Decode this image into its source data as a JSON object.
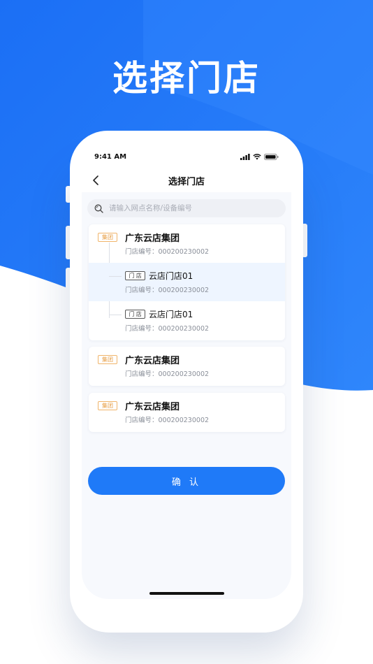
{
  "hero": {
    "title": "选择门店"
  },
  "status_bar": {
    "time": "9:41 AM"
  },
  "nav": {
    "title": "选择门店"
  },
  "search": {
    "placeholder": "请输入网点名称/设备编号"
  },
  "cards": [
    {
      "group": {
        "tag": "集团",
        "name": "广东云店集团",
        "code": "门店编号：000200230002"
      },
      "stores": [
        {
          "tag": "门 店",
          "name": "云店门店01",
          "code": "门店编号：000200230002",
          "selected": true
        },
        {
          "tag": "门 店",
          "name": "云店门店01",
          "code": "门店编号：000200230002",
          "selected": false
        }
      ]
    },
    {
      "group": {
        "tag": "集团",
        "name": "广东云店集团",
        "code": "门店编号：000200230002"
      }
    },
    {
      "group": {
        "tag": "集团",
        "name": "广东云店集团",
        "code": "门店编号：000200230002"
      }
    }
  ],
  "confirm": {
    "label": "确 认"
  },
  "colors": {
    "primary": "#1f7af8",
    "group_tag": "#e69a3d",
    "selected_row": "#eef5ff"
  }
}
